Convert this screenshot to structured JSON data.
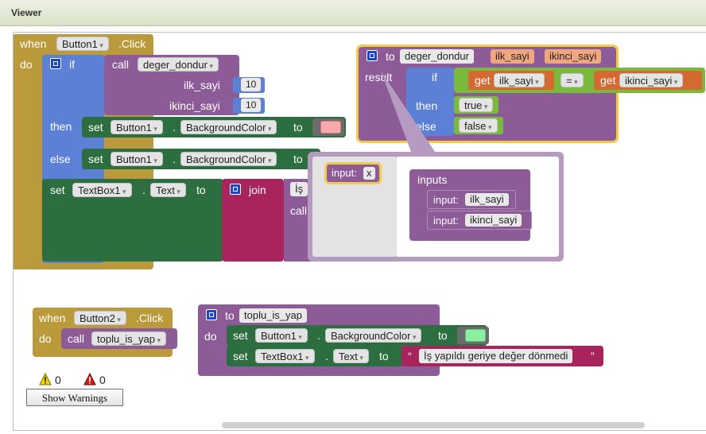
{
  "panel": {
    "title": "Viewer"
  },
  "colors": {
    "pink_swatch": "#f7a8a8",
    "green_swatch": "#88f0a0"
  },
  "icons": [
    "mutator-icon",
    "warning-icon",
    "error-icon"
  ],
  "event1": {
    "when": "when",
    "component": "Button1",
    "event": ".Click",
    "do": "do",
    "if_label": "if",
    "call": "call",
    "procedure": "deger_dondur",
    "arg1_label": "ilk_sayi",
    "arg1_value": "10",
    "arg2_label": "ikinci_sayi",
    "arg2_value": "10",
    "then": "then",
    "else": "else",
    "set": "set",
    "dot": ".",
    "to": "to",
    "then_component": "Button1",
    "then_property": "BackgroundColor",
    "else_component": "Button1",
    "else_property": "BackgroundColor",
    "last_component": "TextBox1",
    "last_property": "Text",
    "join": "join",
    "join_text_partial": "İş",
    "join_call_partial": "call"
  },
  "proc_def": {
    "to": "to",
    "name": "deger_dondur",
    "param1": "ilk_sayi",
    "param2": "ikinci_sayi",
    "result": "result",
    "if_label": "if",
    "get1": "get",
    "get1_var": "ilk_sayi",
    "op": "=",
    "get2": "get",
    "get2_var": "ikinci_sayi",
    "then": "then",
    "then_value": "true",
    "else": "else",
    "else_value": "false"
  },
  "mutator": {
    "input_label": "input:",
    "input_name": "x",
    "inputs_title": "inputs",
    "items": [
      "ilk_sayi",
      "ikinci_sayi"
    ]
  },
  "event2": {
    "when": "when",
    "component": "Button2",
    "event": ".Click",
    "do": "do",
    "call": "call",
    "procedure": "toplu_is_yap"
  },
  "proc2": {
    "to": "to",
    "name": "toplu_is_yap",
    "do": "do",
    "set1": "set",
    "set1_component": "Button1",
    "dot": ".",
    "set1_property": "BackgroundColor",
    "set1_to": "to",
    "set2": "set",
    "set2_component": "TextBox1",
    "set2_property": "Text",
    "set2_to": "to",
    "text_value": "İş yapıldı geriye değer dönmedi"
  },
  "warnings": {
    "warning_count": "0",
    "error_count": "0",
    "button": "Show Warnings"
  }
}
